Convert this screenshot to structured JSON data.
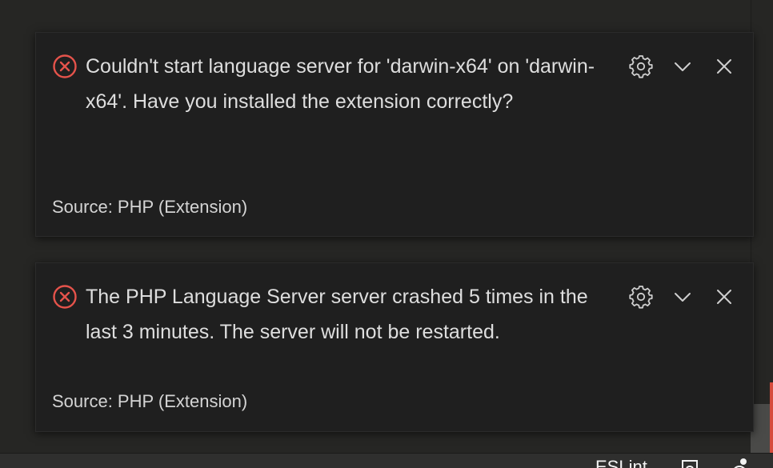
{
  "colors": {
    "error": "#e5534b",
    "toast_bg": "#1f1f1f",
    "text": "#dedede",
    "editor_bg": "#262624"
  },
  "notifications": [
    {
      "icon": "error-circle-icon",
      "message": "Couldn't start language server for 'darwin-x64' on 'darwin-x64'. Have you installed the extension correctly?",
      "source": "Source: PHP (Extension)",
      "actions": [
        "gear-icon",
        "chevron-down-icon",
        "close-icon"
      ]
    },
    {
      "icon": "error-circle-icon",
      "message": "The PHP Language Server server crashed 5 times in the last 3 minutes. The server will not be restarted.",
      "source": "Source: PHP (Extension)",
      "actions": [
        "gear-icon",
        "chevron-down-icon",
        "close-icon"
      ]
    }
  ],
  "status_bar": {
    "eslint_label": "ESLint"
  }
}
